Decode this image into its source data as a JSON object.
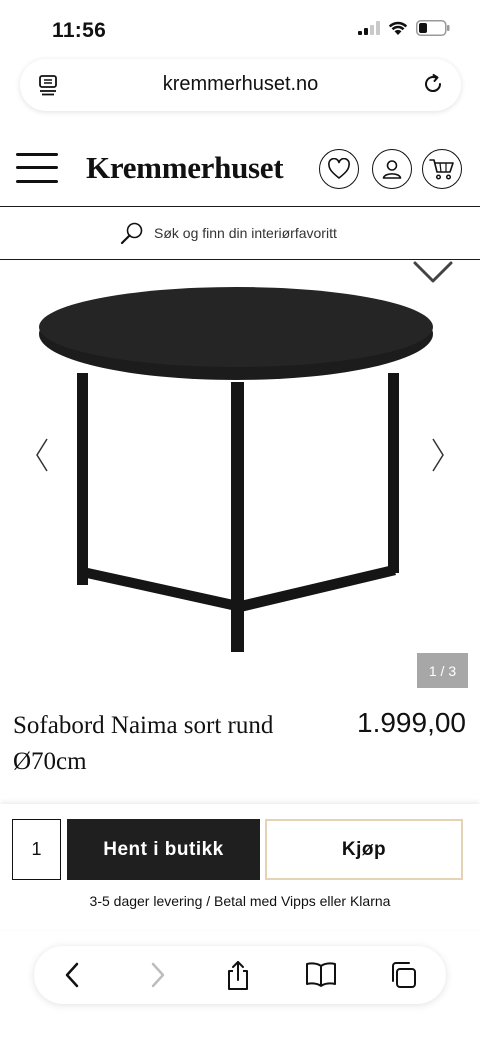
{
  "status_bar": {
    "time": "11:56",
    "icons": [
      "cellular-signal-icon",
      "wifi-icon",
      "battery-icon"
    ]
  },
  "browser": {
    "url": "kremmerhuset.no",
    "icons": [
      "reader-mode-icon",
      "reload-icon"
    ]
  },
  "header": {
    "logo": "Kremmerhuset",
    "icons": [
      "menu-icon",
      "heart-icon",
      "user-icon",
      "cart-icon"
    ]
  },
  "search": {
    "placeholder": "Søk og finn din interiørfavoritt",
    "icon": "search-icon"
  },
  "gallery": {
    "counter": "1 / 3",
    "icons": [
      "wishlist-heart-icon",
      "chevron-left-icon",
      "chevron-right-icon"
    ]
  },
  "product": {
    "title_line1": "Sofabord Naima sort rund",
    "title_line2": "Ø70cm",
    "price": "1.999,00"
  },
  "purchase": {
    "quantity": "1",
    "store_button": "Hent i butikk",
    "buy_button": "Kjøp",
    "delivery_info": "3-5 dager levering / Betal med Vipps eller Klarna"
  },
  "toolbar": {
    "icons": [
      "back-icon",
      "forward-icon",
      "share-icon",
      "bookmarks-icon",
      "tabs-icon"
    ]
  },
  "colors": {
    "dark_button": "#1f1f1f",
    "buy_border": "#e6d2b5",
    "counter_badge": "#a7a7a7"
  }
}
